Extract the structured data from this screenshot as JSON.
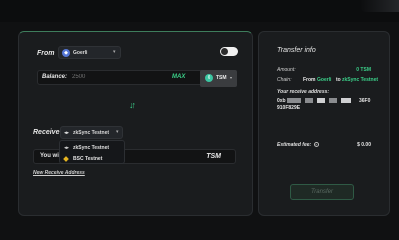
{
  "from": {
    "label": "From",
    "network": "Goerli",
    "network_icon": "ethereum-icon"
  },
  "balance": {
    "label": "Balance:",
    "amount_placeholder": "2500",
    "max_label": "MAX",
    "token": "TSM"
  },
  "receive": {
    "label": "Receive",
    "network": "zkSync Testnet",
    "options": [
      {
        "label": "zkSync Testnet",
        "icon": "zksync-icon"
      },
      {
        "label": "BSC Testnet",
        "icon": "bsc-icon"
      }
    ],
    "will_receive_label": "You will",
    "token": "TSM",
    "new_address_link": "New Receive Address"
  },
  "info": {
    "title": "Transfer info",
    "amount_label": "Amount:",
    "amount_value": "0 TSM",
    "chain_label": "Chain:",
    "chain_from": "From",
    "chain_from_value": "Goerli",
    "chain_to": "to",
    "chain_to_value": "zkSync Testnet",
    "receive_address_label": "Your receive address:",
    "address_line1_start": "0xb",
    "address_line1_end": "36F0",
    "address_line2": "910F829E",
    "fee_label": "Estimated fee:",
    "fee_value": "$ 0.00",
    "transfer_button": "Transfer"
  },
  "colors": {
    "accent": "#3bd18a",
    "panel": "#1a1c1e",
    "background": "#101112",
    "bsc": "#e7b520"
  }
}
